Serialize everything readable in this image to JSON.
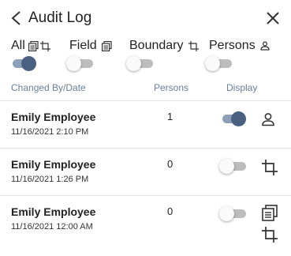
{
  "header": {
    "title": "Audit Log"
  },
  "filters": [
    {
      "label": "All",
      "icons": [
        "field-icon",
        "boundary-icon"
      ],
      "on": true
    },
    {
      "label": "Field",
      "icons": [
        "field-icon"
      ],
      "on": false
    },
    {
      "label": "Boundary",
      "icons": [
        "boundary-icon"
      ],
      "on": false
    },
    {
      "label": "Persons",
      "icons": [
        "person-icon"
      ],
      "on": false
    }
  ],
  "columns": {
    "changed_by": "Changed By/Date",
    "persons": "Persons",
    "display": "Display"
  },
  "rows": [
    {
      "name": "Emily Employee",
      "date": "11/16/2021 2:10 PM",
      "persons": "1",
      "display_on": true,
      "icons": [
        "person-icon"
      ]
    },
    {
      "name": "Emily Employee",
      "date": "11/16/2021 1:26 PM",
      "persons": "0",
      "display_on": false,
      "icons": [
        "boundary-icon"
      ]
    },
    {
      "name": "Emily Employee",
      "date": "11/16/2021 12:00 AM",
      "persons": "0",
      "display_on": false,
      "icons": [
        "field-icon",
        "boundary-icon"
      ]
    }
  ],
  "colors": {
    "accent": "#4a6081",
    "accent_track": "#8ea0b8",
    "header_text": "#6a7f9a"
  }
}
